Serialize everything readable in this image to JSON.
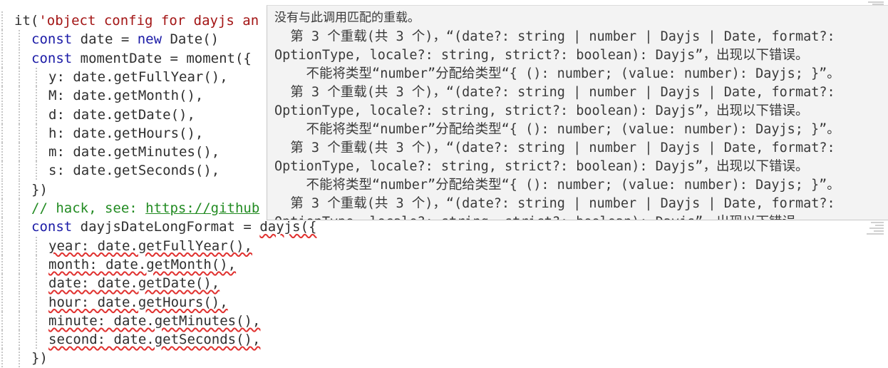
{
  "editor": {
    "lines": [
      {
        "indent": 0,
        "tokens": [
          {
            "t": "it(",
            "c": ""
          },
          {
            "t": "'object config for dayjs an",
            "c": "str"
          }
        ]
      },
      {
        "indent": 1,
        "tokens": [
          {
            "t": "const",
            "c": "kw"
          },
          {
            "t": " date = ",
            "c": ""
          },
          {
            "t": "new",
            "c": "kw"
          },
          {
            "t": " Date()",
            "c": ""
          }
        ]
      },
      {
        "indent": 1,
        "tokens": [
          {
            "t": "const",
            "c": "kw"
          },
          {
            "t": " momentDate = moment({",
            "c": ""
          }
        ]
      },
      {
        "indent": 2,
        "tokens": [
          {
            "t": "y: date.getFullYear(),",
            "c": ""
          }
        ]
      },
      {
        "indent": 2,
        "tokens": [
          {
            "t": "M: date.getMonth(),",
            "c": ""
          }
        ]
      },
      {
        "indent": 2,
        "tokens": [
          {
            "t": "d: date.getDate(),",
            "c": ""
          }
        ]
      },
      {
        "indent": 2,
        "tokens": [
          {
            "t": "h: date.getHours(),",
            "c": ""
          }
        ]
      },
      {
        "indent": 2,
        "tokens": [
          {
            "t": "m: date.getMinutes(),",
            "c": ""
          }
        ]
      },
      {
        "indent": 2,
        "tokens": [
          {
            "t": "s: date.getSeconds(),",
            "c": ""
          }
        ]
      },
      {
        "indent": 1,
        "tokens": [
          {
            "t": "})",
            "c": ""
          }
        ]
      },
      {
        "indent": 1,
        "tokens": [
          {
            "t": "// hack, see: ",
            "c": "cmt"
          },
          {
            "t": "https://github",
            "c": "link"
          }
        ]
      },
      {
        "indent": 1,
        "tokens": [
          {
            "t": "const",
            "c": "kw"
          },
          {
            "t": " dayjsDateLongFormat = ",
            "c": ""
          },
          {
            "t": "dayjs({",
            "c": "err"
          }
        ]
      },
      {
        "indent": 2,
        "tokens": [
          {
            "t": "year: date.getFullYear(),",
            "c": "err"
          }
        ]
      },
      {
        "indent": 2,
        "tokens": [
          {
            "t": "month: date.getMonth(),",
            "c": "err"
          }
        ]
      },
      {
        "indent": 2,
        "tokens": [
          {
            "t": "date: date.getDate(),",
            "c": "err"
          }
        ]
      },
      {
        "indent": 2,
        "tokens": [
          {
            "t": "hour: date.getHours(),",
            "c": "err"
          }
        ]
      },
      {
        "indent": 2,
        "tokens": [
          {
            "t": "minute: date.getMinutes(),",
            "c": "err"
          }
        ]
      },
      {
        "indent": 2,
        "tokens": [
          {
            "t": "second: date.getSeconds(),",
            "c": "err"
          }
        ]
      },
      {
        "indent": 1,
        "tokens": [
          {
            "t": "})",
            "c": ""
          }
        ]
      }
    ]
  },
  "tooltip": {
    "header": "没有与此调用匹配的重载。",
    "lines": [
      "  第 3 个重载(共 3 个)，“(date?: string | number | Dayjs | Date, format?:",
      "OptionType, locale?: string, strict?: boolean): Dayjs”，出现以下错误。",
      "    不能将类型“number”分配给类型“{ (): number; (value: number): Dayjs; }”。",
      "  第 3 个重载(共 3 个)，“(date?: string | number | Dayjs | Date, format?:",
      "OptionType, locale?: string, strict?: boolean): Dayjs”，出现以下错误。",
      "    不能将类型“number”分配给类型“{ (): number; (value: number): Dayjs; }”。",
      "  第 3 个重载(共 3 个)，“(date?: string | number | Dayjs | Date, format?:",
      "OptionType, locale?: string, strict?: boolean): Dayjs”，出现以下错误。",
      "    不能将类型“number”分配给类型“{ (): number; (value: number): Dayjs; }”。",
      "  第 3 个重载(共 3 个)，“(date?: string | number | Dayjs | Date, format?:",
      "OptionType, locale?: string, strict?: boolean): Dayjs”，出现以下错误。"
    ]
  },
  "colors": {
    "keyword": "#1a1aa6",
    "string": "#a31515",
    "comment": "#228b22",
    "error_squiggle": "#e0312f",
    "tooltip_bg": "#f3f3f3"
  }
}
